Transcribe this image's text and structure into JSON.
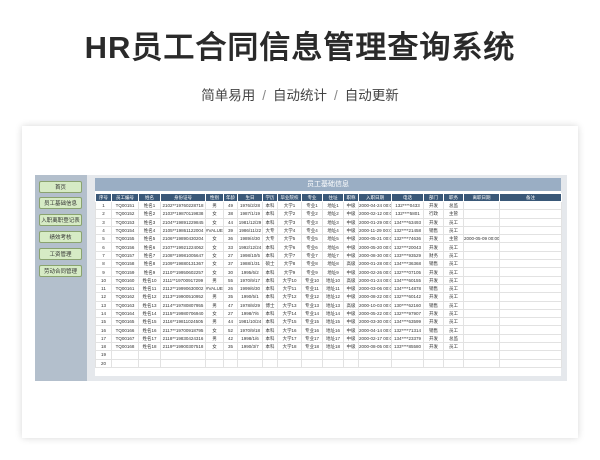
{
  "promo": {
    "title": "HR员工合同信息管理查询系统",
    "tags": [
      "简单易用",
      "自动统计",
      "自动更新"
    ],
    "separator": "/"
  },
  "sidebar": {
    "items": [
      {
        "label": "首页"
      },
      {
        "label": "员工基础信息"
      },
      {
        "label": "入职离职登记表"
      },
      {
        "label": "绩效考核"
      },
      {
        "label": "工资管理"
      },
      {
        "label": "劳动合同管理"
      }
    ]
  },
  "sheet": {
    "title": "员工基础信息",
    "columns": [
      "序号",
      "员工编号",
      "姓名",
      "身份证号",
      "性别",
      "年龄",
      "生日",
      "学历",
      "毕业院校",
      "专业",
      "住址",
      "职称",
      "入职日期",
      "电话",
      "部门",
      "职务",
      "离职日期",
      "备注"
    ],
    "rows": [
      {
        "no": "1",
        "id": "TQ00151",
        "name": "姓名1",
        "idcard": "2102**19760228718",
        "gender": "男",
        "age": "49",
        "birthday": "1976/2/28",
        "edu": "本科",
        "school": "大学1",
        "major": "专业1",
        "address": "地址1",
        "title": "中级",
        "hire": "2000-04-24 00:00:00",
        "phone": "132****0433",
        "dept": "开发",
        "position": "总监",
        "leave": "",
        "note": ""
      },
      {
        "no": "2",
        "id": "TQ00152",
        "name": "姓名2",
        "idcard": "2103**19870119838",
        "gender": "女",
        "age": "38",
        "birthday": "1987/1/19",
        "edu": "本科",
        "school": "大学2",
        "major": "专业2",
        "address": "地址2",
        "title": "中级",
        "hire": "2000-02-12 00:00:00",
        "phone": "132****5801",
        "dept": "行政",
        "position": "主管",
        "leave": "",
        "note": ""
      },
      {
        "no": "3",
        "id": "TQ00153",
        "name": "姓名3",
        "idcard": "2104**19891229845",
        "gender": "女",
        "age": "44",
        "birthday": "1981/12/29",
        "edu": "本科",
        "school": "大学3",
        "major": "专业3",
        "address": "地址3",
        "title": "中级",
        "hire": "2000-01-29 00:00:00",
        "phone": "134****63493",
        "dept": "开发",
        "position": "员工",
        "leave": "",
        "note": ""
      },
      {
        "no": "4",
        "id": "TQ00154",
        "name": "姓名4",
        "idcard": "2105**19861122004",
        "gender": "#VALUE!",
        "age": "39",
        "birthday": "1986/11/22",
        "edu": "大专",
        "school": "大学4",
        "major": "专业4",
        "address": "地址4",
        "title": "中级",
        "hire": "2000-11-29 00:00:00",
        "phone": "132****21458",
        "dept": "销售",
        "position": "员工",
        "leave": "",
        "note": ""
      },
      {
        "no": "5",
        "id": "TQ00155",
        "name": "姓名5",
        "idcard": "2106**19890430204",
        "gender": "女",
        "age": "36",
        "birthday": "1989/4/30",
        "edu": "大专",
        "school": "大学5",
        "major": "专业5",
        "address": "地址5",
        "title": "中级",
        "hire": "2000-05-21 00:00:00",
        "phone": "132****74636",
        "dept": "开发",
        "position": "主管",
        "leave": "2000-05-09 00:00:00",
        "note": ""
      },
      {
        "no": "6",
        "id": "TQ00156",
        "name": "姓名6",
        "idcard": "2107**19921224062",
        "gender": "女",
        "age": "33",
        "birthday": "1992/12/24",
        "edu": "本科",
        "school": "大学6",
        "major": "专业6",
        "address": "地址6",
        "title": "中级",
        "hire": "2000-05-20 00:00:00",
        "phone": "132****20043",
        "dept": "开发",
        "position": "员工",
        "leave": "",
        "note": ""
      },
      {
        "no": "7",
        "id": "TQ00157",
        "name": "姓名7",
        "idcard": "2108**19981005647",
        "gender": "女",
        "age": "27",
        "birthday": "1998/10/5",
        "edu": "本科",
        "school": "大学7",
        "major": "专业7",
        "address": "地址7",
        "title": "中级",
        "hire": "2000-08-30 00:00:00",
        "phone": "133****93529",
        "dept": "财务",
        "position": "员工",
        "leave": "",
        "note": ""
      },
      {
        "no": "8",
        "id": "TQ00158",
        "name": "姓名8",
        "idcard": "2109**19880131367",
        "gender": "女",
        "age": "37",
        "birthday": "1988/1/31",
        "edu": "硕士",
        "school": "大学8",
        "major": "专业8",
        "address": "地址8",
        "title": "高级",
        "hire": "2000-01-28 00:00:00",
        "phone": "134****36368",
        "dept": "销售",
        "position": "员工",
        "leave": "",
        "note": ""
      },
      {
        "no": "9",
        "id": "TQ00159",
        "name": "姓名9",
        "idcard": "2110**19950602257",
        "gender": "女",
        "age": "30",
        "birthday": "1995/6/2",
        "edu": "本科",
        "school": "大学9",
        "major": "专业9",
        "address": "地址9",
        "title": "中级",
        "hire": "2000-02-26 00:00:00",
        "phone": "132****07105",
        "dept": "开发",
        "position": "员工",
        "leave": "",
        "note": ""
      },
      {
        "no": "10",
        "id": "TQ00160",
        "name": "姓名10",
        "idcard": "2111**19700917299",
        "gender": "男",
        "age": "55",
        "birthday": "1970/9/17",
        "edu": "本科",
        "school": "大学10",
        "major": "专业10",
        "address": "地址10",
        "title": "高级",
        "hire": "2000-01-24 00:00:00",
        "phone": "134****60155",
        "dept": "开发",
        "position": "员工",
        "leave": "",
        "note": ""
      },
      {
        "no": "11",
        "id": "TQ00161",
        "name": "姓名11",
        "idcard": "2112**19990630002",
        "gender": "#VALUE!",
        "age": "26",
        "birthday": "1999/6/30",
        "edu": "本科",
        "school": "大学11",
        "major": "专业11",
        "address": "地址11",
        "title": "中级",
        "hire": "2000-03-06 00:00:00",
        "phone": "134****14878",
        "dept": "销售",
        "position": "员工",
        "leave": "",
        "note": ""
      },
      {
        "no": "12",
        "id": "TQ00162",
        "name": "姓名12",
        "idcard": "2113**19900510952",
        "gender": "男",
        "age": "35",
        "birthday": "1990/5/1",
        "edu": "本科",
        "school": "大学12",
        "major": "专业12",
        "address": "地址12",
        "title": "中级",
        "hire": "2000-08-22 00:00:00",
        "phone": "132****60142",
        "dept": "开发",
        "position": "员工",
        "leave": "",
        "note": ""
      },
      {
        "no": "13",
        "id": "TQ00163",
        "name": "姓名13",
        "idcard": "2114**19780807955",
        "gender": "男",
        "age": "47",
        "birthday": "1978/8/29",
        "edu": "博士",
        "school": "大学13",
        "major": "专业13",
        "address": "地址13",
        "title": "高级",
        "hire": "2000-10-03 00:00:00",
        "phone": "130****62160",
        "dept": "销售",
        "position": "员工",
        "leave": "",
        "note": ""
      },
      {
        "no": "14",
        "id": "TQ00164",
        "name": "姓名14",
        "idcard": "2115**19980706940",
        "gender": "女",
        "age": "27",
        "birthday": "1998/7/6",
        "edu": "本科",
        "school": "大学14",
        "major": "专业14",
        "address": "地址14",
        "title": "中级",
        "hire": "2000-05-22 00:00:00",
        "phone": "132****97907",
        "dept": "开发",
        "position": "员工",
        "leave": "",
        "note": ""
      },
      {
        "no": "15",
        "id": "TQ00165",
        "name": "姓名15",
        "idcard": "2116**19811024505",
        "gender": "男",
        "age": "44",
        "birthday": "1981/10/24",
        "edu": "本科",
        "school": "大学15",
        "major": "专业15",
        "address": "地址15",
        "title": "中级",
        "hire": "2000-03-30 00:00:00",
        "phone": "134****63599",
        "dept": "开发",
        "position": "员工",
        "leave": "",
        "note": ""
      },
      {
        "no": "16",
        "id": "TQ00166",
        "name": "姓名16",
        "idcard": "2117**19700918795",
        "gender": "女",
        "age": "52",
        "birthday": "1970/9/18",
        "edu": "本科",
        "school": "大学16",
        "major": "专业16",
        "address": "地址16",
        "title": "中级",
        "hire": "2000-04-14 00:00:00",
        "phone": "132****71314",
        "dept": "销售",
        "position": "员工",
        "leave": "",
        "note": ""
      },
      {
        "no": "17",
        "id": "TQ00167",
        "name": "姓名17",
        "idcard": "2118**19830424316",
        "gender": "男",
        "age": "42",
        "birthday": "1998/1/6",
        "edu": "本科",
        "school": "大学17",
        "major": "专业17",
        "address": "地址17",
        "title": "中级",
        "hire": "2000-02-17 00:00:00",
        "phone": "134****23379",
        "dept": "开发",
        "position": "总监",
        "leave": "",
        "note": ""
      },
      {
        "no": "18",
        "id": "TQ00168",
        "name": "姓名18",
        "idcard": "2119**19900307518",
        "gender": "女",
        "age": "35",
        "birthday": "1990/3/7",
        "edu": "本科",
        "school": "大学18",
        "major": "专业18",
        "address": "地址18",
        "title": "中级",
        "hire": "2000-08-05 00:00:00",
        "phone": "133****85580",
        "dept": "开发",
        "position": "员工",
        "leave": "",
        "note": ""
      },
      {
        "no": "19",
        "id": "",
        "name": "",
        "idcard": "",
        "gender": "",
        "age": "",
        "birthday": "",
        "edu": "",
        "school": "",
        "major": "",
        "address": "",
        "title": "",
        "hire": "",
        "phone": "",
        "dept": "",
        "position": "",
        "leave": "",
        "note": ""
      },
      {
        "no": "20",
        "id": "",
        "name": "",
        "idcard": "",
        "gender": "",
        "age": "",
        "birthday": "",
        "edu": "",
        "school": "",
        "major": "",
        "address": "",
        "title": "",
        "hire": "",
        "phone": "",
        "dept": "",
        "position": "",
        "leave": "",
        "note": ""
      }
    ]
  }
}
